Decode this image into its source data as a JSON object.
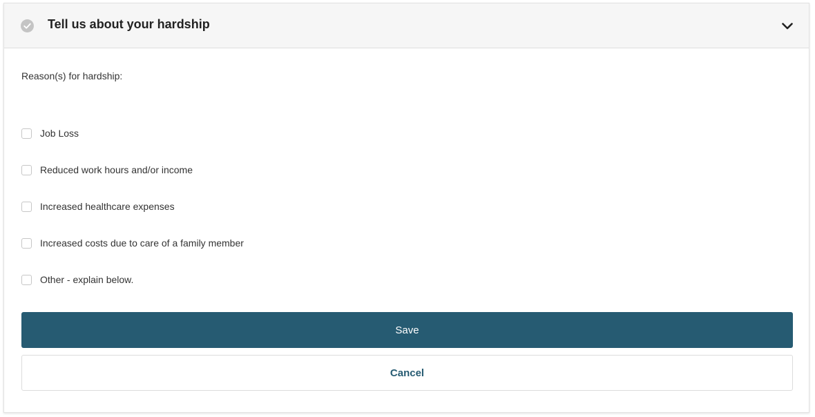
{
  "header": {
    "title": "Tell us about your hardship",
    "status_icon": "check-circle-icon",
    "toggle_icon": "chevron-down-icon"
  },
  "form": {
    "reason_label": "Reason(s) for hardship:",
    "options": [
      {
        "label": "Job Loss",
        "checked": false
      },
      {
        "label": "Reduced work hours and/or income",
        "checked": false
      },
      {
        "label": "Increased healthcare expenses",
        "checked": false
      },
      {
        "label": "Increased costs due to care of a family member",
        "checked": false
      },
      {
        "label": "Other - explain below.",
        "checked": false
      }
    ]
  },
  "actions": {
    "save_label": "Save",
    "cancel_label": "Cancel"
  },
  "colors": {
    "primary": "#265b72",
    "header_bg": "#f6f6f6",
    "status_icon": "#c4c4c4"
  }
}
